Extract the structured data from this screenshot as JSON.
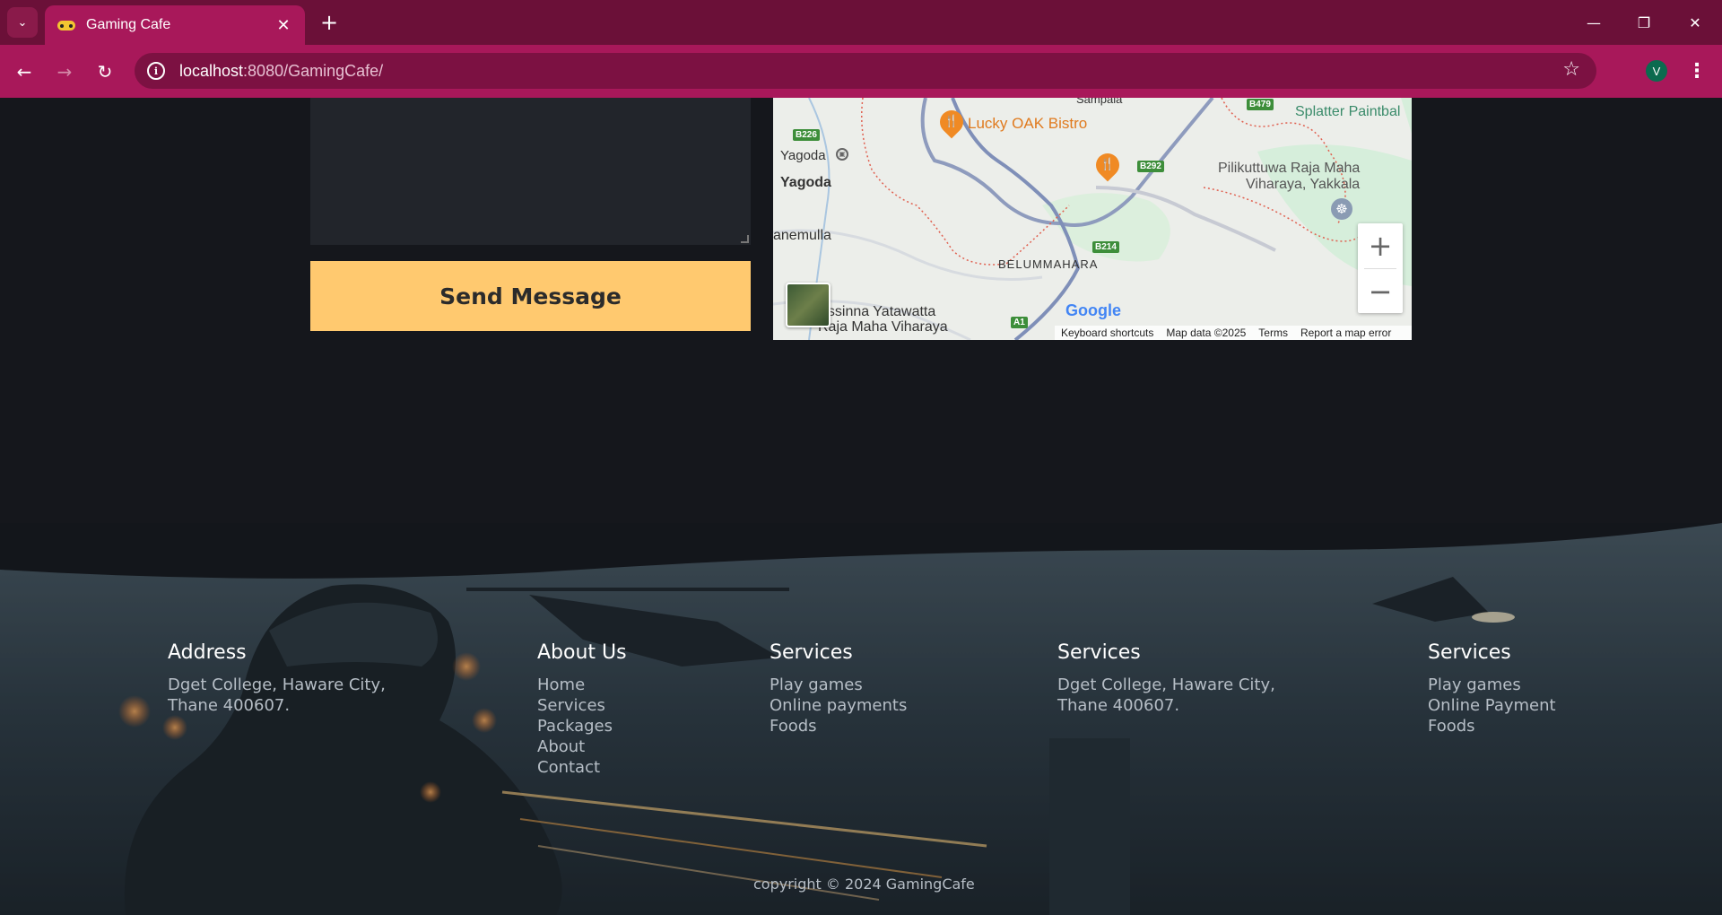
{
  "browser": {
    "tab_title": "Gaming Cafe",
    "url_host": "localhost",
    "url_path": ":8080/GamingCafe/",
    "profile_initial": "V"
  },
  "contact": {
    "send_label": "Send Message"
  },
  "map": {
    "places": {
      "lucky_oak": "Lucky OAK Bistro",
      "splatter": "Splatter Paintbal",
      "yagoda_small": "Yagoda",
      "yagoda": "Yagoda",
      "pilikuttuwa_1": "Pilikuttuwa Raja Maha",
      "pilikuttuwa_2": "Viharaya, Yakkala",
      "anemulla": "anemulla",
      "belummahara": "BELUMMAHARA",
      "gossinna_1": "ossinna Yatawatta",
      "gossinna_2": "Raja Maha Viharaya",
      "sampala": "Sampala"
    },
    "roads": {
      "b226": "B226",
      "b479": "B479",
      "b292": "B292",
      "b214": "B214",
      "a1": "A1"
    },
    "google": "Google",
    "footer": {
      "shortcuts": "Keyboard shortcuts",
      "data": "Map data ©2025",
      "terms": "Terms",
      "report": "Report a map error"
    }
  },
  "footer": {
    "col1": {
      "title": "Address",
      "lines": [
        "Dget College, Haware City,",
        "Thane 400607."
      ]
    },
    "col2": {
      "title": "About Us",
      "links": [
        "Home",
        "Services",
        "Packages",
        "About",
        "Contact"
      ]
    },
    "col3": {
      "title": "Services",
      "links": [
        "Play games",
        "Online payments",
        "Foods"
      ]
    },
    "col4": {
      "title": "Services",
      "lines": [
        "Dget College, Haware City,",
        "Thane 400607."
      ]
    },
    "col5": {
      "title": "Services",
      "links": [
        "Play games",
        "Online Payment",
        "Foods"
      ]
    },
    "copyright": "copyright © 2024 GamingCafe"
  }
}
